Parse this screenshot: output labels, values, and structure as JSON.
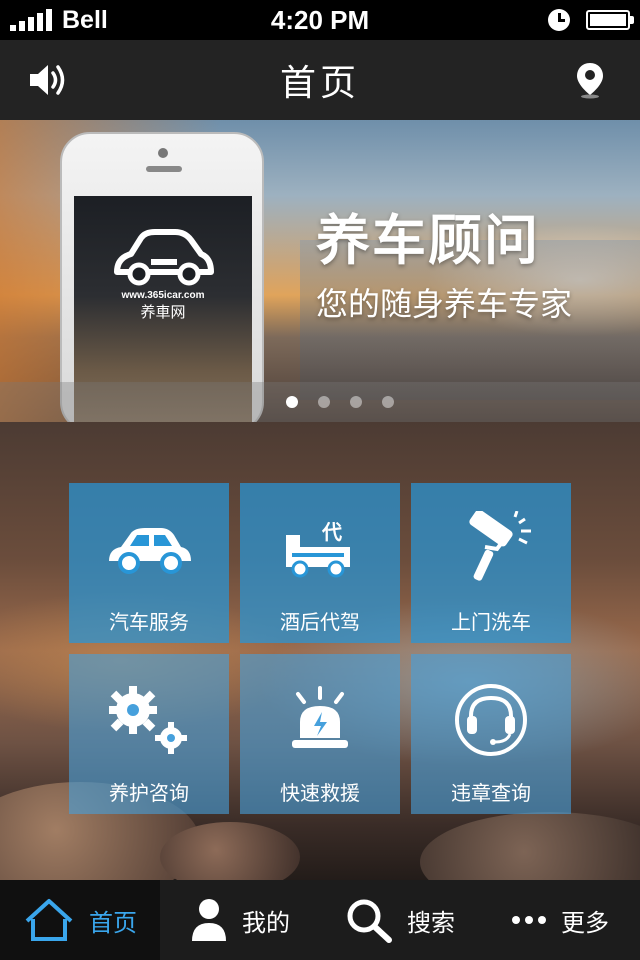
{
  "status_bar": {
    "carrier": "Bell",
    "time": "4:20 PM"
  },
  "nav": {
    "title": "首页",
    "left_icon": "speaker-icon",
    "right_icon": "location-pin-icon"
  },
  "banner": {
    "logo_url": "www.365icar.com",
    "logo_name": "养車网",
    "title": "养车顾问",
    "subtitle": "您的随身养车专家",
    "pages": 4,
    "active_page": 1
  },
  "services": [
    {
      "label": "汽车服务",
      "icon": "car-icon"
    },
    {
      "label": "酒后代驾",
      "icon": "designated-driver-icon",
      "badge": "代"
    },
    {
      "label": "上门洗车",
      "icon": "paint-roller-icon"
    },
    {
      "label": "养护咨询",
      "icon": "gears-icon"
    },
    {
      "label": "快速救援",
      "icon": "siren-icon"
    },
    {
      "label": "违章查询",
      "icon": "headset-icon"
    }
  ],
  "tabs": [
    {
      "label": "首页",
      "icon": "home-icon",
      "active": true
    },
    {
      "label": "我的",
      "icon": "user-icon",
      "active": false
    },
    {
      "label": "搜索",
      "icon": "search-icon",
      "active": false
    },
    {
      "label": "更多",
      "icon": "more-icon",
      "active": false
    }
  ],
  "colors": {
    "accent": "#3aa6ec",
    "tile": "#2896d7",
    "bar": "#232323"
  }
}
